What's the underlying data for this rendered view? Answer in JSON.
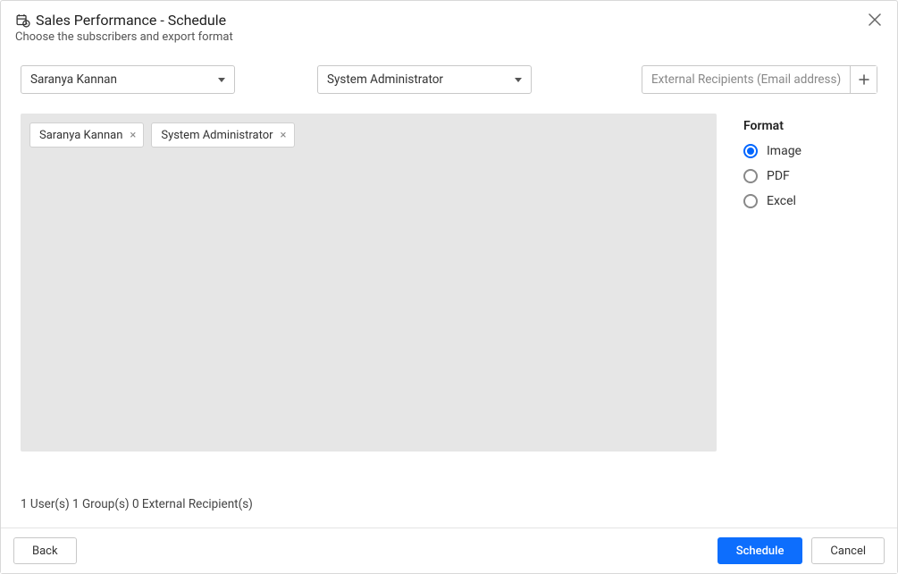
{
  "header": {
    "title": "Sales Performance - Schedule",
    "subtitle": "Choose the subscribers and export format"
  },
  "selectors": {
    "user_selected": "Saranya Kannan",
    "group_selected": "System Administrator",
    "external_placeholder": "External Recipients (Email address)"
  },
  "chips": [
    {
      "label": "Saranya Kannan"
    },
    {
      "label": "System Administrator"
    }
  ],
  "format": {
    "title": "Format",
    "options": [
      {
        "label": "Image",
        "selected": true
      },
      {
        "label": "PDF",
        "selected": false
      },
      {
        "label": "Excel",
        "selected": false
      }
    ]
  },
  "summary": "1 User(s) 1 Group(s) 0 External Recipient(s)",
  "footer": {
    "back": "Back",
    "schedule": "Schedule",
    "cancel": "Cancel"
  }
}
